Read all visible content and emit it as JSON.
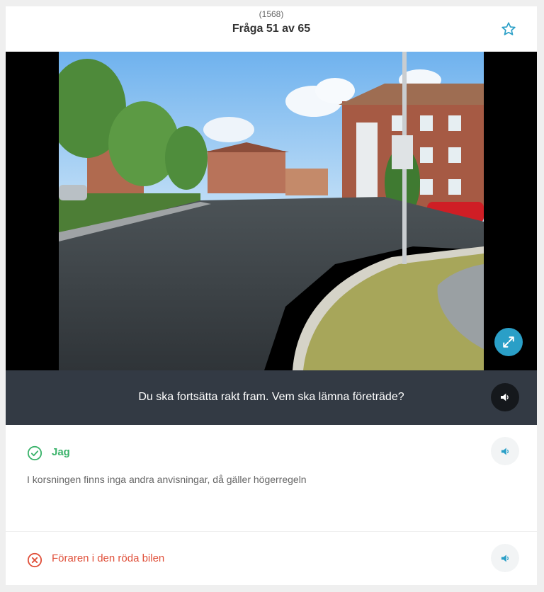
{
  "header": {
    "question_id": "(1568)",
    "title": "Fråga 51 av 65",
    "favorite_icon": "star-icon"
  },
  "media": {
    "expand_icon": "expand-icon"
  },
  "question": {
    "text": "Du ska fortsätta rakt fram. Vem ska lämna företräde?",
    "sound_icon": "speaker-icon"
  },
  "answers": [
    {
      "label": "Jag",
      "status": "correct",
      "status_icon": "check-circle-icon",
      "explanation": "I korsningen finns inga andra anvisningar, då gäller högerregeln",
      "color": "#3bb36b"
    },
    {
      "label": "Föraren i den röda bilen",
      "status": "wrong",
      "status_icon": "x-circle-icon",
      "color": "#e0503a"
    }
  ],
  "colors": {
    "accent": "#2a9fc7",
    "question_bar": "#333a44",
    "correct": "#3bb36b",
    "wrong": "#e0503a"
  }
}
